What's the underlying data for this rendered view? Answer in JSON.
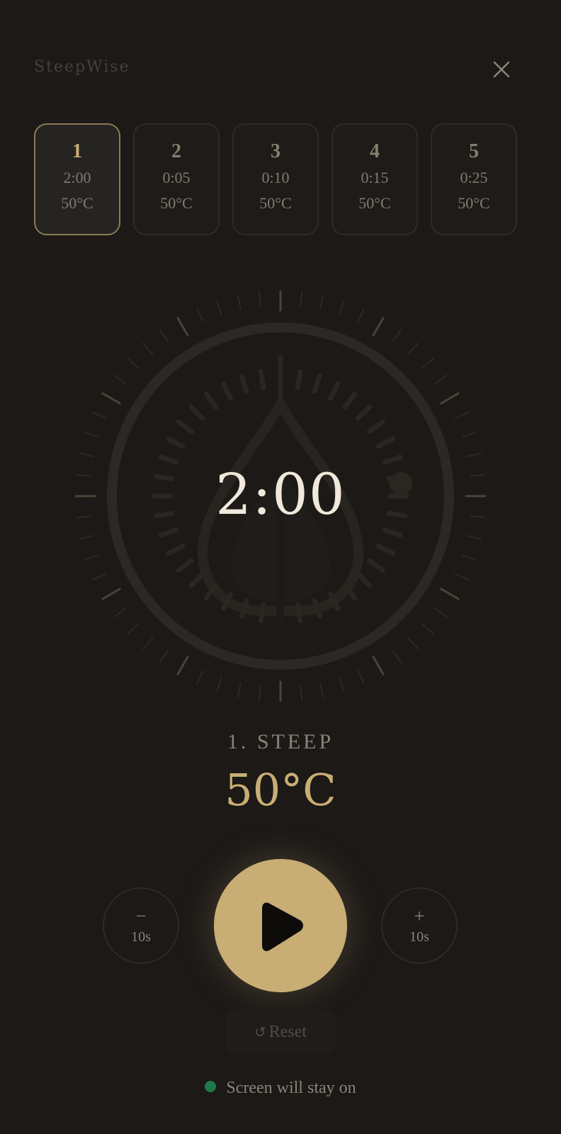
{
  "app": {
    "title": "SteepWise"
  },
  "infusions": [
    {
      "number": "1",
      "time": "2:00",
      "temp": "50°C",
      "active": true
    },
    {
      "number": "2",
      "time": "0:05",
      "temp": "50°C",
      "active": false
    },
    {
      "number": "3",
      "time": "0:10",
      "temp": "50°C",
      "active": false
    },
    {
      "number": "4",
      "time": "0:15",
      "temp": "50°C",
      "active": false
    },
    {
      "number": "5",
      "time": "0:25",
      "temp": "50°C",
      "active": false
    }
  ],
  "timer": {
    "display": "2:00",
    "progress": 0
  },
  "step": {
    "label": "1. STEEP",
    "temp": "50°C"
  },
  "controls": {
    "minus_sign": "−",
    "minus_label": "10s",
    "plus_sign": "+",
    "plus_label": "10s",
    "play_icon": "play-icon",
    "reset_icon": "↺",
    "reset_label": "Reset"
  },
  "status": {
    "wake_text": "Screen will stay on",
    "wake_color": "#1f7a4a"
  },
  "colors": {
    "accent": "#c8ae74",
    "background": "#1c1917"
  },
  "icons": {
    "close": "close-icon",
    "leaf": "leaf-icon"
  }
}
